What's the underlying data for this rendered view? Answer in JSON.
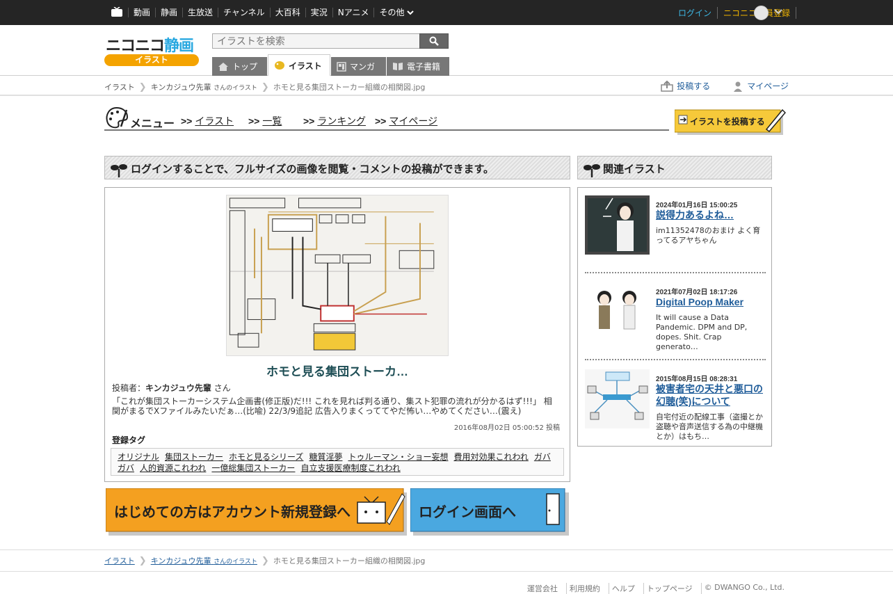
{
  "topbar": {
    "nav": [
      "動画",
      "静画",
      "生放送",
      "チャンネル",
      "大百科",
      "実況",
      "Nアニメ"
    ],
    "more": "その他",
    "login": "ログイン",
    "register": "ニコニコ会員登録"
  },
  "header": {
    "logo_main": "ニコニコ",
    "logo_kanji": "静画",
    "logo_sub": "イラスト",
    "search_placeholder": "イラストを検索",
    "tabs": [
      "トップ",
      "イラスト",
      "マンガ",
      "電子書籍"
    ]
  },
  "breadcrumb": {
    "root": "イラスト",
    "author": "キンカジュウ先輩",
    "author_suffix": "さんのイラスト",
    "current": "ホモと見る集団ストーカー組織の相関図.jpg",
    "post": "投稿する",
    "mypage": "マイページ"
  },
  "menu": {
    "label": "メニュー",
    "arrow": ">>",
    "items": [
      "イラスト",
      "一覧",
      "ランキング",
      "マイページ"
    ],
    "post_button": "イラストを投稿する"
  },
  "main": {
    "login_notice": "ログインすることで、フルサイズの画像を閲覧・コメントの投稿ができます。",
    "title": "ホモと見る集団ストーカ…",
    "poster_label": "投稿者：",
    "poster_name": "キンカジュウ先輩",
    "poster_suffix": " さん",
    "description": "「これが集団ストーカーシステム企画書(修正版)だ!!! これを見れば判る通り、集スト犯罪の流れが分かるはず!!!」 相関がまるでXファイルみたいだぁ…(比喩) 22/3/9追記 広告入りまくっててやだ怖い…やめてください…(震え)",
    "post_date": "2016年08月02日 05:00:52 投稿",
    "tags_label": "登録タグ",
    "tags": [
      "オリジナル",
      "集団ストーカー",
      "ホモと見るシリーズ",
      "糖質淫夢",
      "トゥルーマン・ショー妄想",
      "費用対効果これわれ",
      "ガバガバ",
      "人的資源これわれ",
      "一億総集団ストーカー",
      "自立支援医療制度これわれ"
    ]
  },
  "banners": {
    "register": "はじめての方はアカウント新規登録へ",
    "login": "ログイン画面へ"
  },
  "related": {
    "label": "関連イラスト",
    "items": [
      {
        "date": "2024年01月16日 15:00:25",
        "title": "説得力あるよね…",
        "desc": "im11352478のおまけ よく育ってるアヤちゃん"
      },
      {
        "date": "2021年07月02日 18:17:26",
        "title": "Digital Poop Maker",
        "desc": "It will cause a Data Pandemic. DPM and DP, dopes. Shit. Crap generato…"
      },
      {
        "date": "2015年08月15日 08:28:31",
        "title": "被害者宅の天井と悪口の幻聴(笑)について",
        "desc": "自宅付近の配線工事（盗撮とか盗聴や音声送信する為の中継機とか）はもち…"
      }
    ]
  },
  "footer": {
    "links": [
      "運営会社",
      "利用規約",
      "ヘルプ",
      "トップページ",
      "© DWANGO Co., Ltd."
    ]
  }
}
